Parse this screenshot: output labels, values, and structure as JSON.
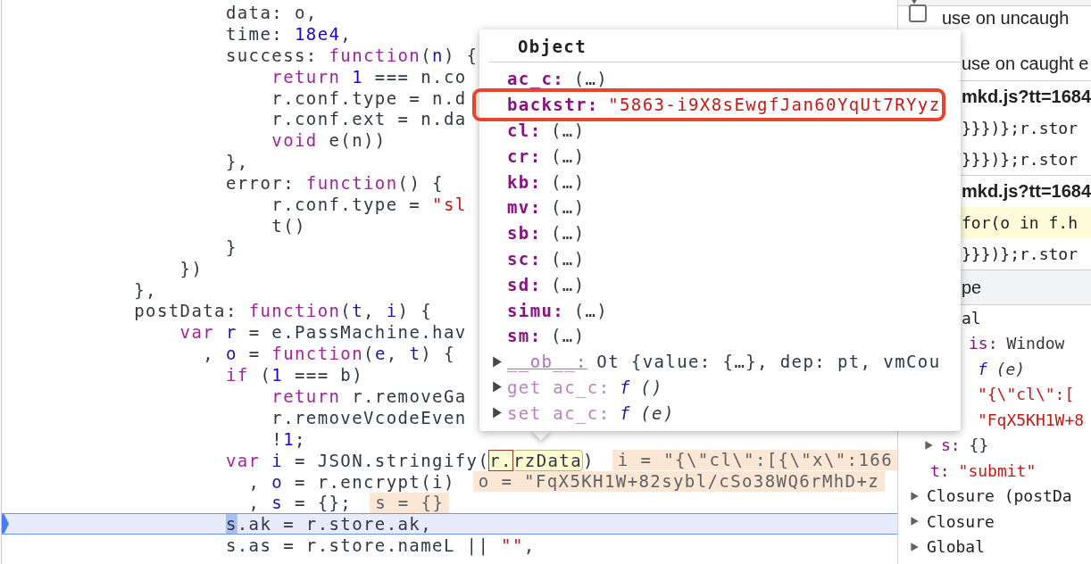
{
  "code": {
    "lines": [
      {
        "current": false,
        "tokens": [
          {
            "text": "                   data: o,",
            "kind": "plain"
          }
        ]
      },
      {
        "current": false,
        "tokens": [
          {
            "text": "                   time: ",
            "kind": "plain"
          },
          {
            "text": "18e4",
            "kind": "number"
          },
          {
            "text": ",",
            "kind": "plain"
          }
        ]
      },
      {
        "current": false,
        "tokens": [
          {
            "text": "                   success: ",
            "kind": "plain"
          },
          {
            "text": "function",
            "kind": "keyword"
          },
          {
            "text": "(",
            "kind": "plain"
          },
          {
            "text": "n",
            "kind": "param"
          },
          {
            "text": ") {",
            "kind": "plain"
          }
        ]
      },
      {
        "current": false,
        "tokens": [
          {
            "text": "                       return",
            "kind": "keyword"
          },
          {
            "text": " 1",
            "kind": "number"
          },
          {
            "text": " === n.co",
            "kind": "plain"
          }
        ]
      },
      {
        "current": false,
        "tokens": [
          {
            "text": "                       r.conf.type = n.d",
            "kind": "plain"
          }
        ]
      },
      {
        "current": false,
        "tokens": [
          {
            "text": "                       r.conf.ext = n.da",
            "kind": "plain"
          }
        ]
      },
      {
        "current": false,
        "tokens": [
          {
            "text": "                       void",
            "kind": "keyword"
          },
          {
            "text": " e(n))",
            "kind": "plain"
          }
        ]
      },
      {
        "current": false,
        "tokens": [
          {
            "text": "                   },",
            "kind": "plain"
          }
        ]
      },
      {
        "current": false,
        "tokens": [
          {
            "text": "                   error: ",
            "kind": "plain"
          },
          {
            "text": "function",
            "kind": "keyword"
          },
          {
            "text": "() {",
            "kind": "plain"
          }
        ]
      },
      {
        "current": false,
        "tokens": [
          {
            "text": "                       r.conf.type = ",
            "kind": "plain"
          },
          {
            "text": "\"sl",
            "kind": "string"
          }
        ]
      },
      {
        "current": false,
        "tokens": [
          {
            "text": "                       t()",
            "kind": "plain"
          }
        ]
      },
      {
        "current": false,
        "tokens": [
          {
            "text": "                   }",
            "kind": "plain"
          }
        ]
      },
      {
        "current": false,
        "tokens": [
          {
            "text": "               })",
            "kind": "plain"
          }
        ]
      },
      {
        "current": false,
        "tokens": [
          {
            "text": "           },",
            "kind": "plain"
          }
        ]
      },
      {
        "current": false,
        "tokens": [
          {
            "text": "           postData: ",
            "kind": "plain"
          },
          {
            "text": "function",
            "kind": "keyword"
          },
          {
            "text": "(",
            "kind": "plain"
          },
          {
            "text": "t",
            "kind": "param"
          },
          {
            "text": ", ",
            "kind": "plain"
          },
          {
            "text": "i",
            "kind": "param"
          },
          {
            "text": ") {",
            "kind": "plain"
          }
        ]
      },
      {
        "current": false,
        "tokens": [
          {
            "text": "               var",
            "kind": "keyword"
          },
          {
            "text": " r",
            "kind": "param"
          },
          {
            "text": " = e.PassMachine.hav",
            "kind": "plain"
          }
        ]
      },
      {
        "current": false,
        "tokens": [
          {
            "text": "                 , ",
            "kind": "plain"
          },
          {
            "text": "o",
            "kind": "param"
          },
          {
            "text": " = ",
            "kind": "plain"
          },
          {
            "text": "function",
            "kind": "keyword"
          },
          {
            "text": "(",
            "kind": "plain"
          },
          {
            "text": "e",
            "kind": "param"
          },
          {
            "text": ", ",
            "kind": "plain"
          },
          {
            "text": "t",
            "kind": "param"
          },
          {
            "text": ") {",
            "kind": "plain"
          }
        ]
      },
      {
        "current": false,
        "tokens": [
          {
            "text": "                   if",
            "kind": "keyword"
          },
          {
            "text": " (",
            "kind": "plain"
          },
          {
            "text": "1",
            "kind": "number"
          },
          {
            "text": " === b)",
            "kind": "plain"
          }
        ]
      },
      {
        "current": false,
        "tokens": [
          {
            "text": "                       return",
            "kind": "keyword"
          },
          {
            "text": " r.removeGa",
            "kind": "plain"
          }
        ]
      },
      {
        "current": false,
        "tokens": [
          {
            "text": "                       r.removeVcodeEven",
            "kind": "plain"
          }
        ]
      },
      {
        "current": false,
        "tokens": [
          {
            "text": "                       !",
            "kind": "plain"
          },
          {
            "text": "1",
            "kind": "number"
          },
          {
            "text": ";",
            "kind": "plain"
          }
        ]
      },
      {
        "current": false,
        "tokens": [
          {
            "text": "                   var",
            "kind": "keyword"
          },
          {
            "text": " i",
            "kind": "param"
          },
          {
            "text": " = JSON.stringify(",
            "kind": "plain"
          },
          {
            "text": "r.",
            "kind": "hover-object"
          },
          {
            "text": "rzData",
            "kind": "hover-property"
          },
          {
            "text": ")",
            "kind": "plain"
          }
        ],
        "inline_value": "i = \"{\\\"cl\\\":[{\\\"x\\\":166"
      },
      {
        "current": false,
        "tokens": [
          {
            "text": "                     , ",
            "kind": "plain"
          },
          {
            "text": "o",
            "kind": "param"
          },
          {
            "text": " = r.encrypt(i)",
            "kind": "plain"
          }
        ],
        "inline_value": "o = \"FqX5KH1W+82sybl/cSo38WQ6rMhD+z"
      },
      {
        "current": false,
        "tokens": [
          {
            "text": "                     , ",
            "kind": "plain"
          },
          {
            "text": "s",
            "kind": "param"
          },
          {
            "text": " = {};",
            "kind": "plain"
          }
        ],
        "inline_value": "s = {}"
      },
      {
        "current": true,
        "tokens": [
          {
            "text": "                   s",
            "kind": "cursor"
          },
          {
            "text": ".ak = r.store.ak,",
            "kind": "plain"
          }
        ]
      },
      {
        "current": false,
        "tokens": [
          {
            "text": "                   s.as = r.store.nameL || ",
            "kind": "plain"
          },
          {
            "text": "\"\"",
            "kind": "string"
          },
          {
            "text": ",",
            "kind": "plain"
          }
        ]
      }
    ]
  },
  "popover": {
    "title": "Object",
    "properties": [
      {
        "key": "ac_c:",
        "value": "(…)",
        "kind": "own",
        "highlighted": false
      },
      {
        "key": "backstr:",
        "value": "\"5863-i9X8sEwgfJan60YqUt7RYyz",
        "kind": "string",
        "highlighted": true
      },
      {
        "key": "cl:",
        "value": "(…)",
        "kind": "own",
        "highlighted": false
      },
      {
        "key": "cr:",
        "value": "(…)",
        "kind": "own",
        "highlighted": false
      },
      {
        "key": "kb:",
        "value": "(…)",
        "kind": "own",
        "highlighted": false
      },
      {
        "key": "mv:",
        "value": "(…)",
        "kind": "own",
        "highlighted": false
      },
      {
        "key": "sb:",
        "value": "(…)",
        "kind": "own",
        "highlighted": false
      },
      {
        "key": "sc:",
        "value": "(…)",
        "kind": "own",
        "highlighted": false
      },
      {
        "key": "sd:",
        "value": "(…)",
        "kind": "own",
        "highlighted": false
      },
      {
        "key": "simu:",
        "value": "(…)",
        "kind": "own",
        "highlighted": false
      },
      {
        "key": "sm:",
        "value": "(…)",
        "kind": "own",
        "highlighted": false
      },
      {
        "key": "__ob__:",
        "value": "Ot {value: {…}, dep: pt, vmCou",
        "kind": "internal",
        "expanded": false,
        "highlighted": false
      },
      {
        "key": "get ac_c:",
        "fn_mark": "f",
        "value": "()",
        "kind": "accessor",
        "expanded": false,
        "highlighted": false
      },
      {
        "key": "set ac_c:",
        "fn_mark": "f",
        "value": "(e)",
        "kind": "accessor",
        "expanded": false,
        "highlighted": false
      }
    ]
  },
  "sidebar": {
    "breakpoints": {
      "expanded": true,
      "options": [
        {
          "label": "use on uncaugh",
          "checked": false
        },
        {
          "label": "use on caught e"
        }
      ],
      "files": [
        {
          "name": "mkd.js?tt=1684",
          "entries": [
            {
              "code": "}}})};r.stor",
              "hit": false
            },
            {
              "code": "}}})};r.stor",
              "hit": false
            }
          ]
        },
        {
          "name": "mkd.js?tt=1684",
          "entries": [
            {
              "code": "for(o in f.h",
              "hit": true
            },
            {
              "code": "}}})};r.stor",
              "hit": false
            }
          ]
        }
      ]
    },
    "scope": {
      "title": "pe",
      "sections": [
        {
          "label": "al",
          "children": [
            {
              "key": "is:",
              "value": "Window",
              "kind": "object"
            },
            {
              "fn_mark": "f",
              "value": "(e)",
              "kind": "function"
            },
            {
              "value": "\"{\\\"cl\\\":[",
              "kind": "string"
            },
            {
              "value": "\"FqX5KH1W+8",
              "kind": "string"
            },
            {
              "key": "s:",
              "value": "{}",
              "kind": "object",
              "expanded": false
            },
            {
              "key": "t:",
              "value": "\"submit\"",
              "kind": "string"
            }
          ]
        },
        {
          "label": "Closure (postDa",
          "expanded": false
        },
        {
          "label": "Closure",
          "expanded": false
        },
        {
          "label": "Global",
          "expanded": false
        }
      ]
    }
  }
}
